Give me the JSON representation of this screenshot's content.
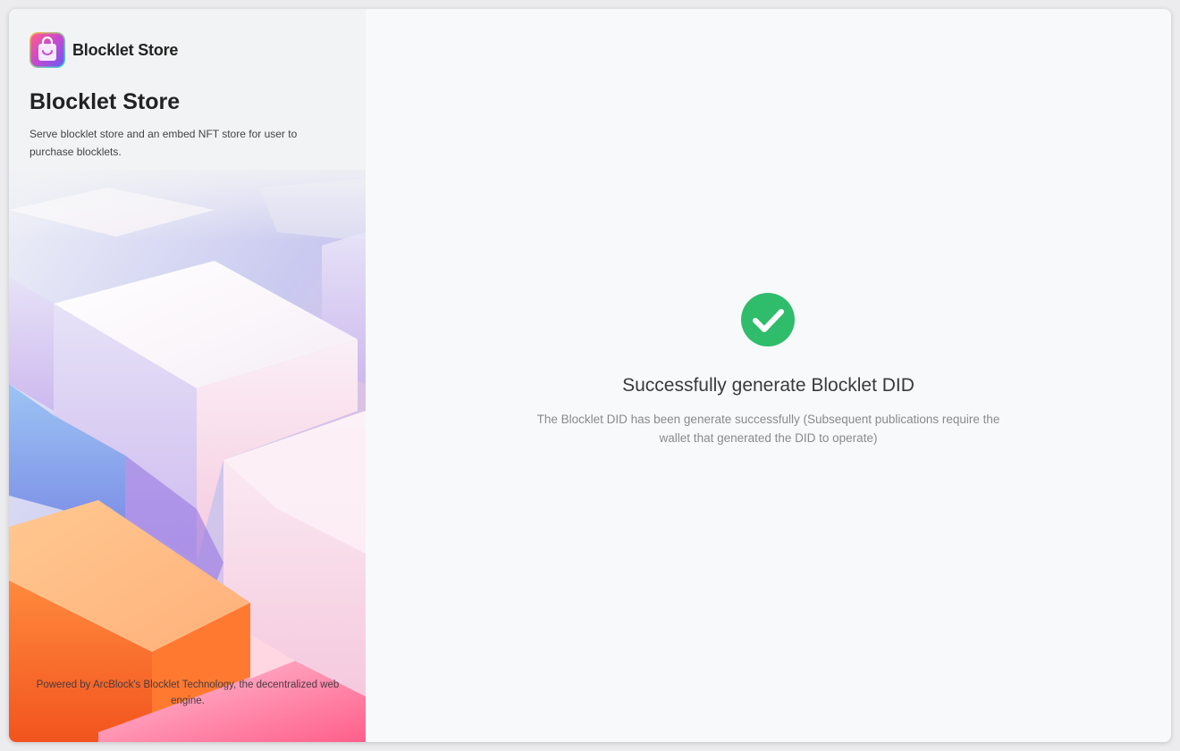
{
  "brand": {
    "name": "Blocklet Store",
    "logo_icon": "shopping-bag-icon"
  },
  "intro": {
    "title": "Blocklet Store",
    "description": "Serve blocklet store and an embed NFT store for user to purchase blocklets."
  },
  "footer": {
    "powered_by": "Powered by ArcBlock's Blocklet Technology, the decentralized web engine."
  },
  "result": {
    "icon": "check-circle-icon",
    "title": "Successfully generate Blocklet DID",
    "description": "The Blocklet DID has been generate successfully (Subsequent publications require the wallet that generated the DID to operate)"
  },
  "colors": {
    "success": "#2fbd6c",
    "title_text": "#222222",
    "muted_text": "#8a8a8a"
  }
}
